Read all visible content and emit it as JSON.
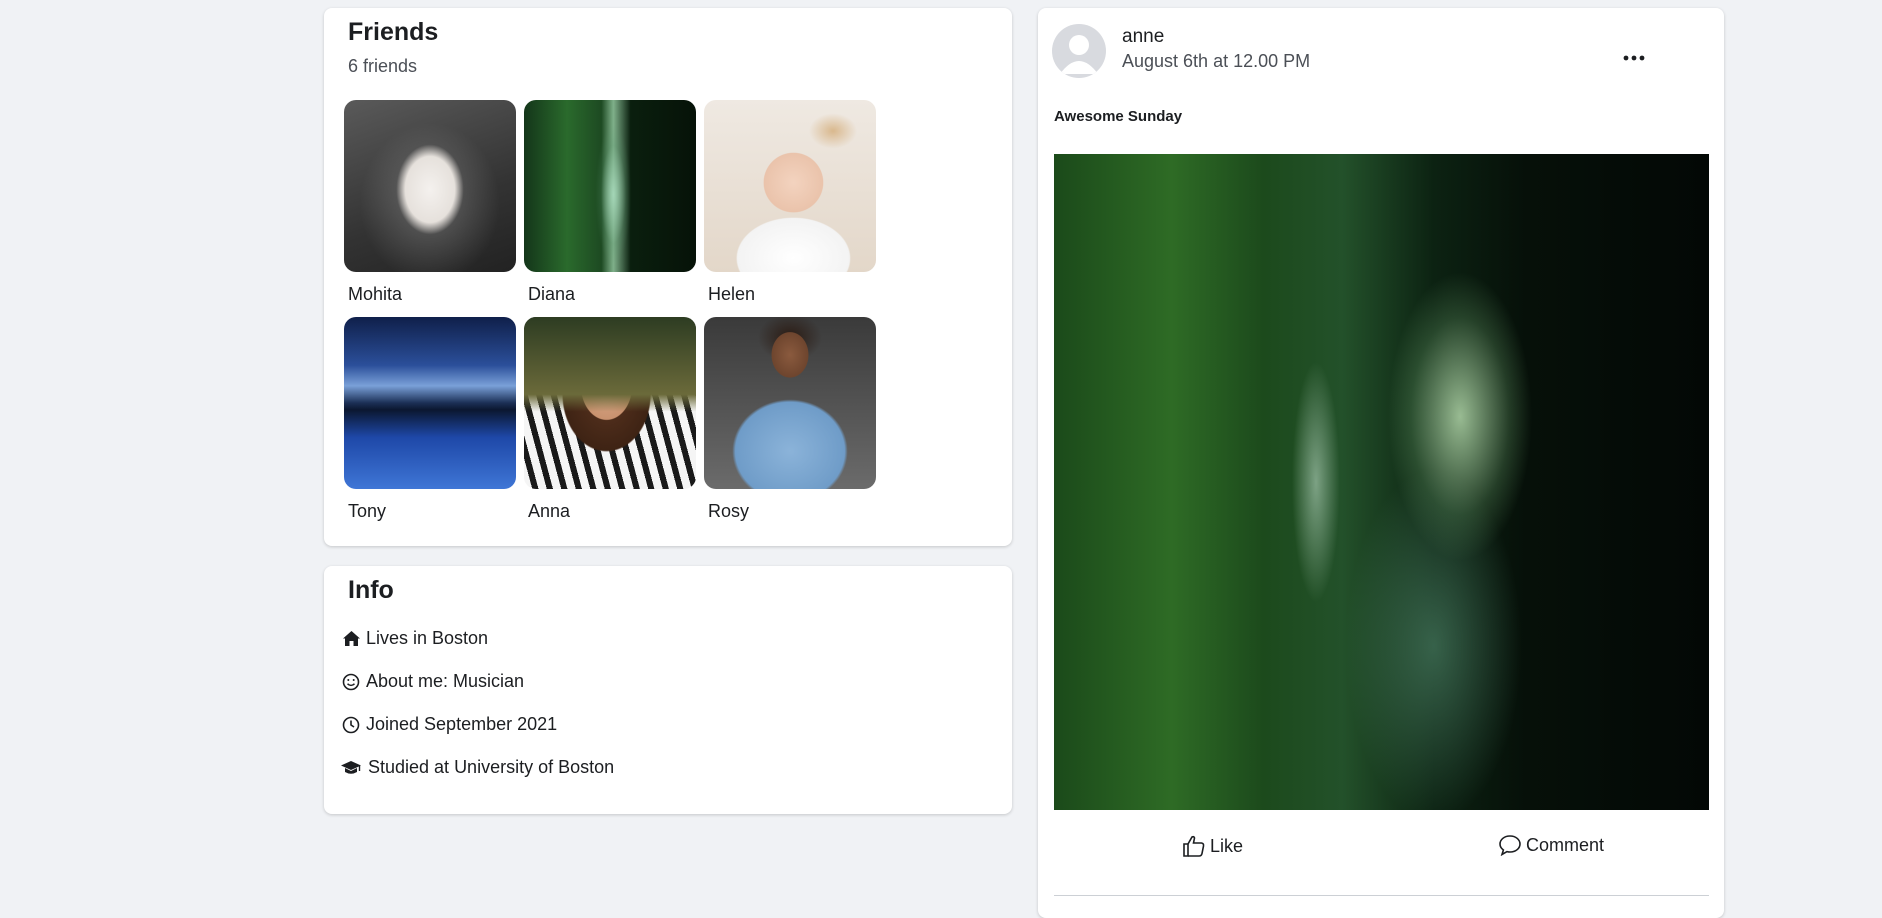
{
  "friends": {
    "title": "Friends",
    "count": "6 friends",
    "items": [
      {
        "name": "Mohita"
      },
      {
        "name": "Diana"
      },
      {
        "name": "Helen"
      },
      {
        "name": "Tony"
      },
      {
        "name": "Anna"
      },
      {
        "name": "Rosy"
      }
    ]
  },
  "info": {
    "title": "Info",
    "items": [
      {
        "icon": "home-icon",
        "text": "Lives in Boston"
      },
      {
        "icon": "smile-icon",
        "text": "About me: Musician"
      },
      {
        "icon": "clock-icon",
        "text": "Joined September 2021"
      },
      {
        "icon": "graduation-cap-icon",
        "text": "Studied at University of Boston"
      }
    ]
  },
  "post": {
    "user": "anne",
    "time": "August 6th at 12.00 PM",
    "text": "Awesome Sunday",
    "like_label": "Like",
    "comment_label": "Comment"
  },
  "colors": {
    "page_background": "#f0f2f5",
    "card_background": "#ffffff",
    "text_primary": "#1c1e21",
    "text_secondary": "#4b4f56"
  }
}
